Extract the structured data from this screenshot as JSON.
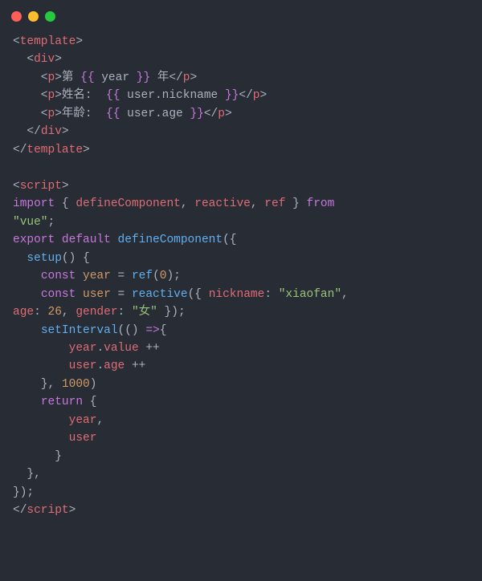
{
  "window_controls": [
    "red",
    "yellow",
    "green"
  ],
  "lines": {
    "l1": {
      "a": "<",
      "b": "template",
      "c": ">"
    },
    "l2": {
      "a": "  <",
      "b": "div",
      "c": ">"
    },
    "l3": {
      "a": "    <",
      "b": "p",
      "c": ">",
      "d": "第 ",
      "e": "{{",
      "f": " year ",
      "g": "}}",
      "h": " 年",
      "i": "</",
      "j": "p",
      "k": ">"
    },
    "l4": {
      "a": "    <",
      "b": "p",
      "c": ">",
      "d": "姓名:  ",
      "e": "{{",
      "f": " user.nickname ",
      "g": "}}",
      "h": "</",
      "i": "p",
      "j": ">"
    },
    "l5": {
      "a": "    <",
      "b": "p",
      "c": ">",
      "d": "年龄:  ",
      "e": "{{",
      "f": " user.age ",
      "g": "}}",
      "h": "</",
      "i": "p",
      "j": ">"
    },
    "l6": {
      "a": "  </",
      "b": "div",
      "c": ">"
    },
    "l7": {
      "a": "</",
      "b": "template",
      "c": ">"
    },
    "l8": "",
    "l9": {
      "a": "<",
      "b": "script",
      "c": ">"
    },
    "l10": {
      "a": "import",
      "b": " { ",
      "c": "defineComponent",
      "d": ", ",
      "e": "reactive",
      "f": ", ",
      "g": "ref",
      "h": " } ",
      "i": "from"
    },
    "l11": {
      "a": "\"vue\"",
      "b": ";"
    },
    "l12": {
      "a": "export",
      "b": " ",
      "c": "default",
      "d": " ",
      "e": "defineComponent",
      "f": "({"
    },
    "l13": {
      "a": "  ",
      "b": "setup",
      "c": "() {"
    },
    "l14": {
      "a": "    ",
      "b": "const",
      "c": " ",
      "d": "year",
      "e": " = ",
      "f": "ref",
      "g": "(",
      "h": "0",
      "i": ");"
    },
    "l15": {
      "a": "    ",
      "b": "const",
      "c": " ",
      "d": "user",
      "e": " = ",
      "f": "reactive",
      "g": "({ ",
      "h": "nickname",
      "i": ": ",
      "j": "\"xiaofan\"",
      "k": ","
    },
    "l16": {
      "a": "age",
      "b": ": ",
      "c": "26",
      "d": ", ",
      "e": "gender",
      "f": ": ",
      "g": "\"女\"",
      "h": " });"
    },
    "l17": {
      "a": "    ",
      "b": "setInterval",
      "c": "(() ",
      "d": "=>",
      "e": "{"
    },
    "l18": {
      "a": "        ",
      "b": "year",
      "c": ".",
      "d": "value",
      "e": " ++"
    },
    "l19": {
      "a": "        ",
      "b": "user",
      "c": ".",
      "d": "age",
      "e": " ++"
    },
    "l20": {
      "a": "    }, ",
      "b": "1000",
      "c": ")"
    },
    "l21": {
      "a": "    ",
      "b": "return",
      "c": " {"
    },
    "l22": {
      "a": "        ",
      "b": "year",
      "c": ","
    },
    "l23": {
      "a": "        ",
      "b": "user"
    },
    "l24": {
      "a": "      }"
    },
    "l25": {
      "a": "  },"
    },
    "l26": {
      "a": "});"
    },
    "l27": {
      "a": "</",
      "b": "script",
      "c": ">"
    }
  }
}
